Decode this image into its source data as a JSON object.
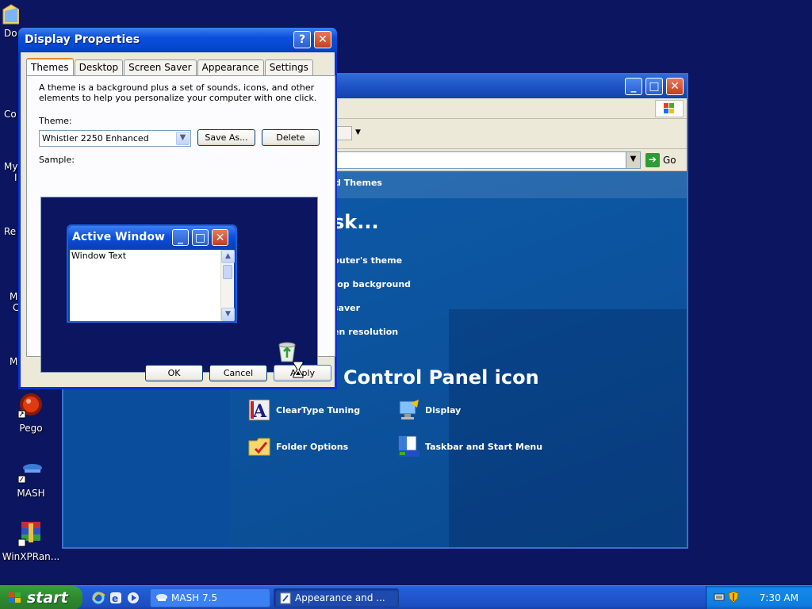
{
  "desktop": {
    "partial_labels": [
      "Do",
      "Co",
      "My",
      "I",
      "Re",
      "M",
      "C",
      "M"
    ],
    "icons": [
      {
        "name": "pego",
        "label": "Pego"
      },
      {
        "name": "mash",
        "label": "MASH"
      },
      {
        "name": "winxpran",
        "label": "WinXPRan..."
      }
    ]
  },
  "explorer": {
    "address": {
      "go_label": "Go"
    },
    "crumb": "d Themes",
    "task_heading": "sk...",
    "tasks": [
      "puter's theme",
      "top background",
      " saver",
      "en resolution"
    ],
    "icon_heading": "Control Panel icon",
    "cp_items": [
      "ClearType Tuning",
      "Display",
      "Folder Options",
      "Taskbar and Start Menu"
    ]
  },
  "dialog": {
    "title": "Display Properties",
    "tabs": [
      "Themes",
      "Desktop",
      "Screen Saver",
      "Appearance",
      "Settings"
    ],
    "description": "A theme is a background plus a set of sounds, icons, and other elements to help you personalize your computer with one click.",
    "theme_label": "Theme:",
    "theme_value": "Whistler 2250 Enhanced",
    "save_as": "Save As...",
    "delete": "Delete",
    "sample_label": "Sample:",
    "preview": {
      "title": "Active Window",
      "body_text": "Window Text"
    },
    "ok": "OK",
    "cancel": "Cancel",
    "apply": "Apply"
  },
  "taskbar": {
    "start_label": "start",
    "tasks": [
      {
        "label": "MASH 7.5",
        "active": false
      },
      {
        "label": "Appearance and ...",
        "active": true
      }
    ],
    "clock": "7:30 AM"
  }
}
